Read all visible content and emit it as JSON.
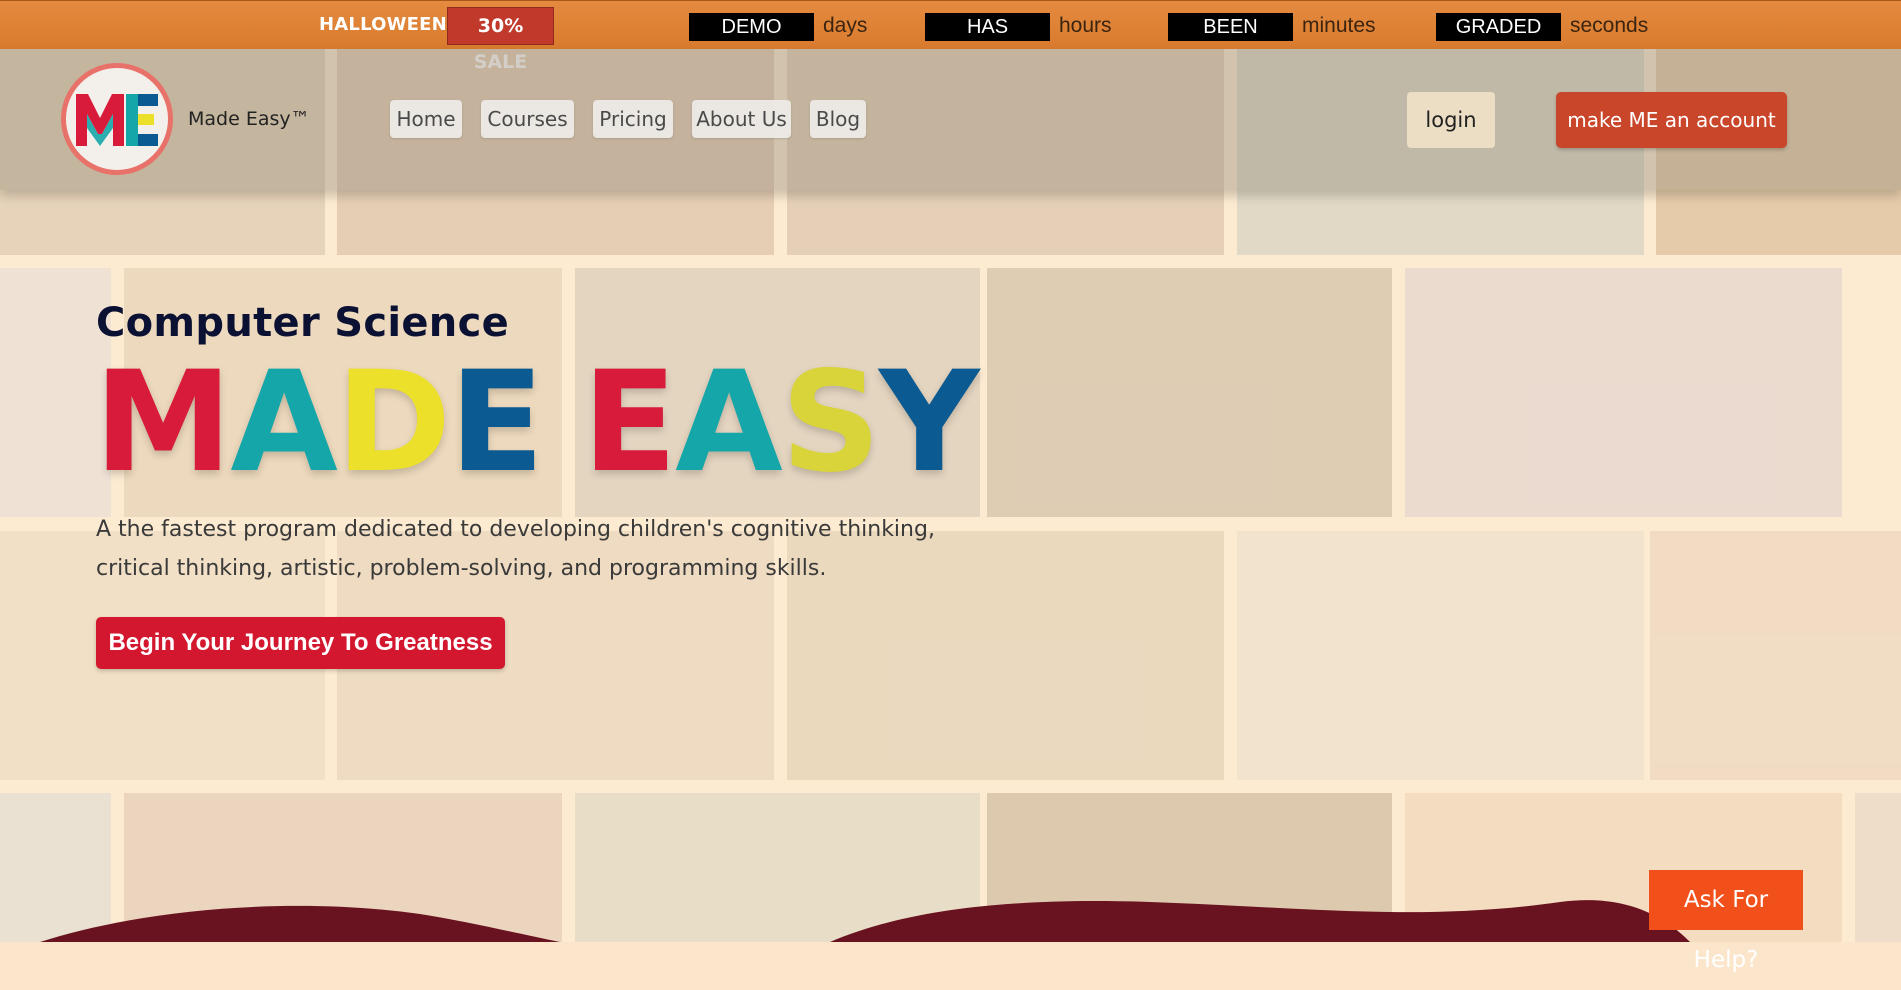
{
  "promo": {
    "event_label": "HALLOWEEN",
    "sale_label": "30% SALE",
    "countdown": [
      {
        "value": "DEMO",
        "unit": "days"
      },
      {
        "value": "HAS",
        "unit": "hours"
      },
      {
        "value": "BEEN",
        "unit": "minutes"
      },
      {
        "value": "GRADED",
        "unit": "seconds"
      }
    ]
  },
  "header": {
    "logo_text": "ME",
    "brand_name": "Made Easy™",
    "nav": [
      {
        "label": "Home"
      },
      {
        "label": "Courses"
      },
      {
        "label": "Pricing"
      },
      {
        "label": "About Us"
      },
      {
        "label": "Blog"
      }
    ],
    "login_label": "login",
    "signup_label": "make ME an account"
  },
  "hero": {
    "kicker": "Computer Science",
    "title_letters": [
      {
        "char": "M",
        "color": "#d81b3a"
      },
      {
        "char": "A",
        "color": "#14a6a8"
      },
      {
        "char": "D",
        "color": "#ece02a"
      },
      {
        "char": "E",
        "color": "#0b5a91"
      },
      {
        "char": " ",
        "color": "#000000"
      },
      {
        "char": "E",
        "color": "#d81b3a"
      },
      {
        "char": "A",
        "color": "#14a6a8"
      },
      {
        "char": "S",
        "color": "#d8d43a"
      },
      {
        "char": "Y",
        "color": "#0b5a91"
      }
    ],
    "description_line1": "A the fastest program dedicated to developing children's cognitive thinking,",
    "description_line2": "critical thinking, artistic, problem-solving, and programming skills.",
    "cta_label": "Begin Your Journey To Greatness"
  },
  "help_label": "Ask For Help?",
  "colors": {
    "promo_bar": "#dd8236",
    "sale_badge": "#c0392b",
    "signup": "#c9462a",
    "cta": "#d3172f",
    "help": "#f2501a",
    "wave": "#6a1320"
  }
}
